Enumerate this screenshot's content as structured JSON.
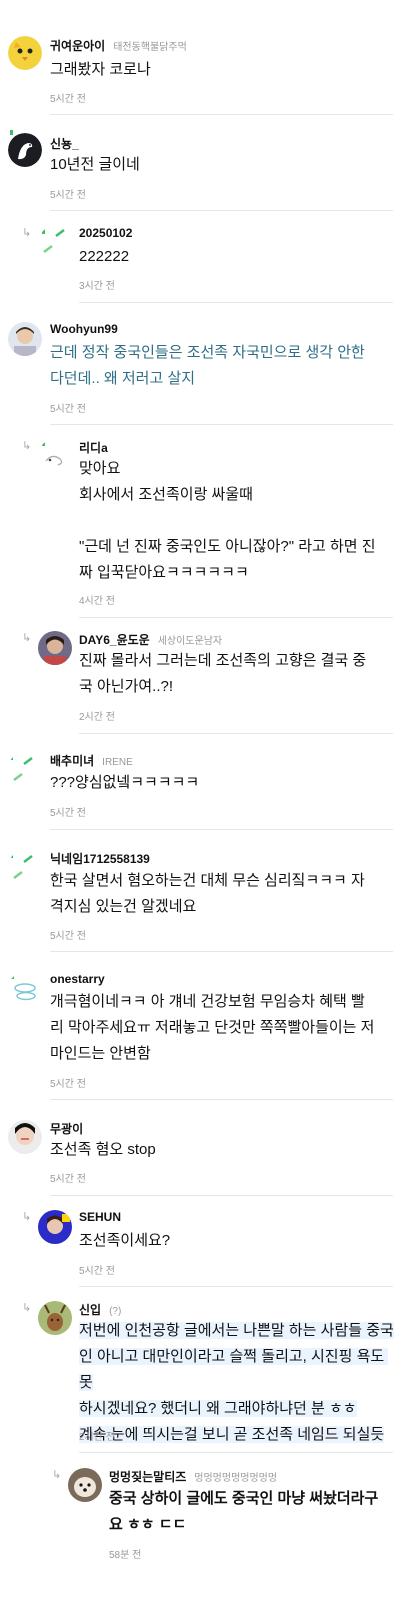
{
  "comments": [
    {
      "nick": "귀여운아이",
      "sub": "태전동핵불닭주먹",
      "body": "그래봤자 코로나",
      "time": "5시간 전"
    },
    {
      "nick": "신뇽_",
      "sub": "",
      "body": "10년전 글이네",
      "time": "5시간 전"
    },
    {
      "nick": "20250102",
      "sub": "",
      "body": "222222",
      "time": "3시간 전"
    },
    {
      "nick": "Woohyun99",
      "sub": "",
      "body": "근데 정작 중국인들은 조선족 자국민으로 생각 안한\n다던데.. 왜 저러고 살지",
      "time": "5시간 전"
    },
    {
      "nick": "리디a",
      "sub": "",
      "body": "맞아요\n회사에서 조선족이랑 싸울때\n\n\"근데 넌 진짜 중국인도 아니잖아?\" 라고 하면 진\n짜 입꾹닫아요ㅋㅋㅋㅋㅋㅋ",
      "time": "4시간 전"
    },
    {
      "nick": "DAY6_윤도운",
      "sub": "세상이도운남자",
      "body": "진짜 몰라서 그러는데 조선족의 고향은 결국 중\n국 아닌가여..?!",
      "time": "2시간 전"
    },
    {
      "nick": "배추미녀",
      "sub": "IRENE",
      "body": "???양심없넼ㅋㅋㅋㅋㅋ",
      "time": "5시간 전"
    },
    {
      "nick": "닉네임1712558139",
      "sub": "",
      "body": "한국 살면서 혐오하는건 대체 무슨 심리짘ㅋㅋㅋ 자\n격지심 있는건 알겠네요",
      "time": "5시간 전"
    },
    {
      "nick": "onestarry",
      "sub": "",
      "body": "개극혐이네ㅋㅋ 아 걔네 건강보험 무임승차 혜택 빨\n리 막아주세요ㅠ 저래놓고 단것만 쪽쪽빨아들이는 저\n마인드는 안변함",
      "time": "5시간 전"
    },
    {
      "nick": "무광이",
      "sub": "",
      "body": "조선족 혐오 stop",
      "time": "5시간 전"
    },
    {
      "nick": "SEHUN",
      "sub": "",
      "body": "조선족이세요?",
      "time": "5시간 전"
    },
    {
      "nick": "신입",
      "sub": "(?)",
      "body": "저번에 인천공항 글에서는 나쁜말 하는 사람들 중국\n인 아니고 대만인이라고 슬쩍 돌리고, 시진핑 욕도 못\n하시겠네요? 했더니 왜 그래야하냐던 분 ㅎㅎ\n계속 눈에 띄시는걸 보니 곧 조선족 네임드 되실듯",
      "time": "2시간 전"
    },
    {
      "nick": "멍멍짖는말티즈",
      "sub": "멍멍멍멍멍멍멍멍멍",
      "body": "중국 상하이 글에도 중국인 마냥 써놨더라구\n요 ㅎㅎ ㄷㄷ",
      "time": "58분 전"
    }
  ],
  "reply_arrow": "↳",
  "colors": {
    "teal_text": "#2e6f86",
    "meta_gray": "#999999",
    "separator": "#e6e6e6",
    "highlight": "#eaf4ff"
  },
  "icons": [
    "chick-avatar",
    "swan-avatar",
    "pinwheel-avatar",
    "person-avatar",
    "sketch-avatar",
    "person-avatar",
    "pinwheel-avatar",
    "pinwheel-avatar",
    "cloud-avatar",
    "person-avatar",
    "person-avatar",
    "deer-avatar",
    "dog-avatar"
  ]
}
